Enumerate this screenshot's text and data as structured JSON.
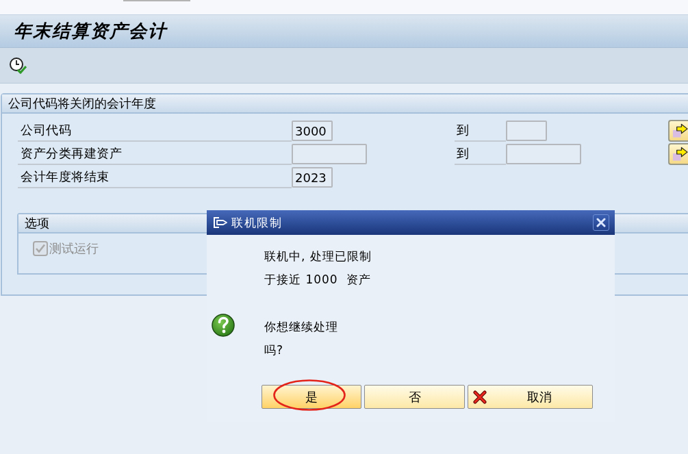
{
  "window": {
    "title": "年末结算资产会计"
  },
  "selection_group": {
    "title": "公司代码将关闭的会计年度",
    "rows": [
      {
        "kind": "range",
        "label": "公司代码",
        "value": "3000",
        "to_label": "到"
      },
      {
        "kind": "range",
        "label": "资产分类再建资产",
        "to_label": "到"
      },
      {
        "kind": "single",
        "label": "会计年度将结束",
        "value": "2023"
      }
    ]
  },
  "options_group": {
    "title": "选项",
    "checkboxes": [
      {
        "label": "测试运行",
        "checked": true,
        "disabled": true
      }
    ]
  },
  "dialog": {
    "title": "联机限制",
    "message_lines": [
      "联机中, 处理已限制",
      "于接近 1000  资产"
    ],
    "question_lines": [
      "你想继续处理",
      "吗?"
    ],
    "buttons": [
      {
        "kind": "default",
        "label": "是",
        "circled": true
      },
      {
        "kind": "plain",
        "label": "否",
        "circled": false
      },
      {
        "kind": "cancel",
        "label": "取消",
        "circled": false
      }
    ]
  }
}
